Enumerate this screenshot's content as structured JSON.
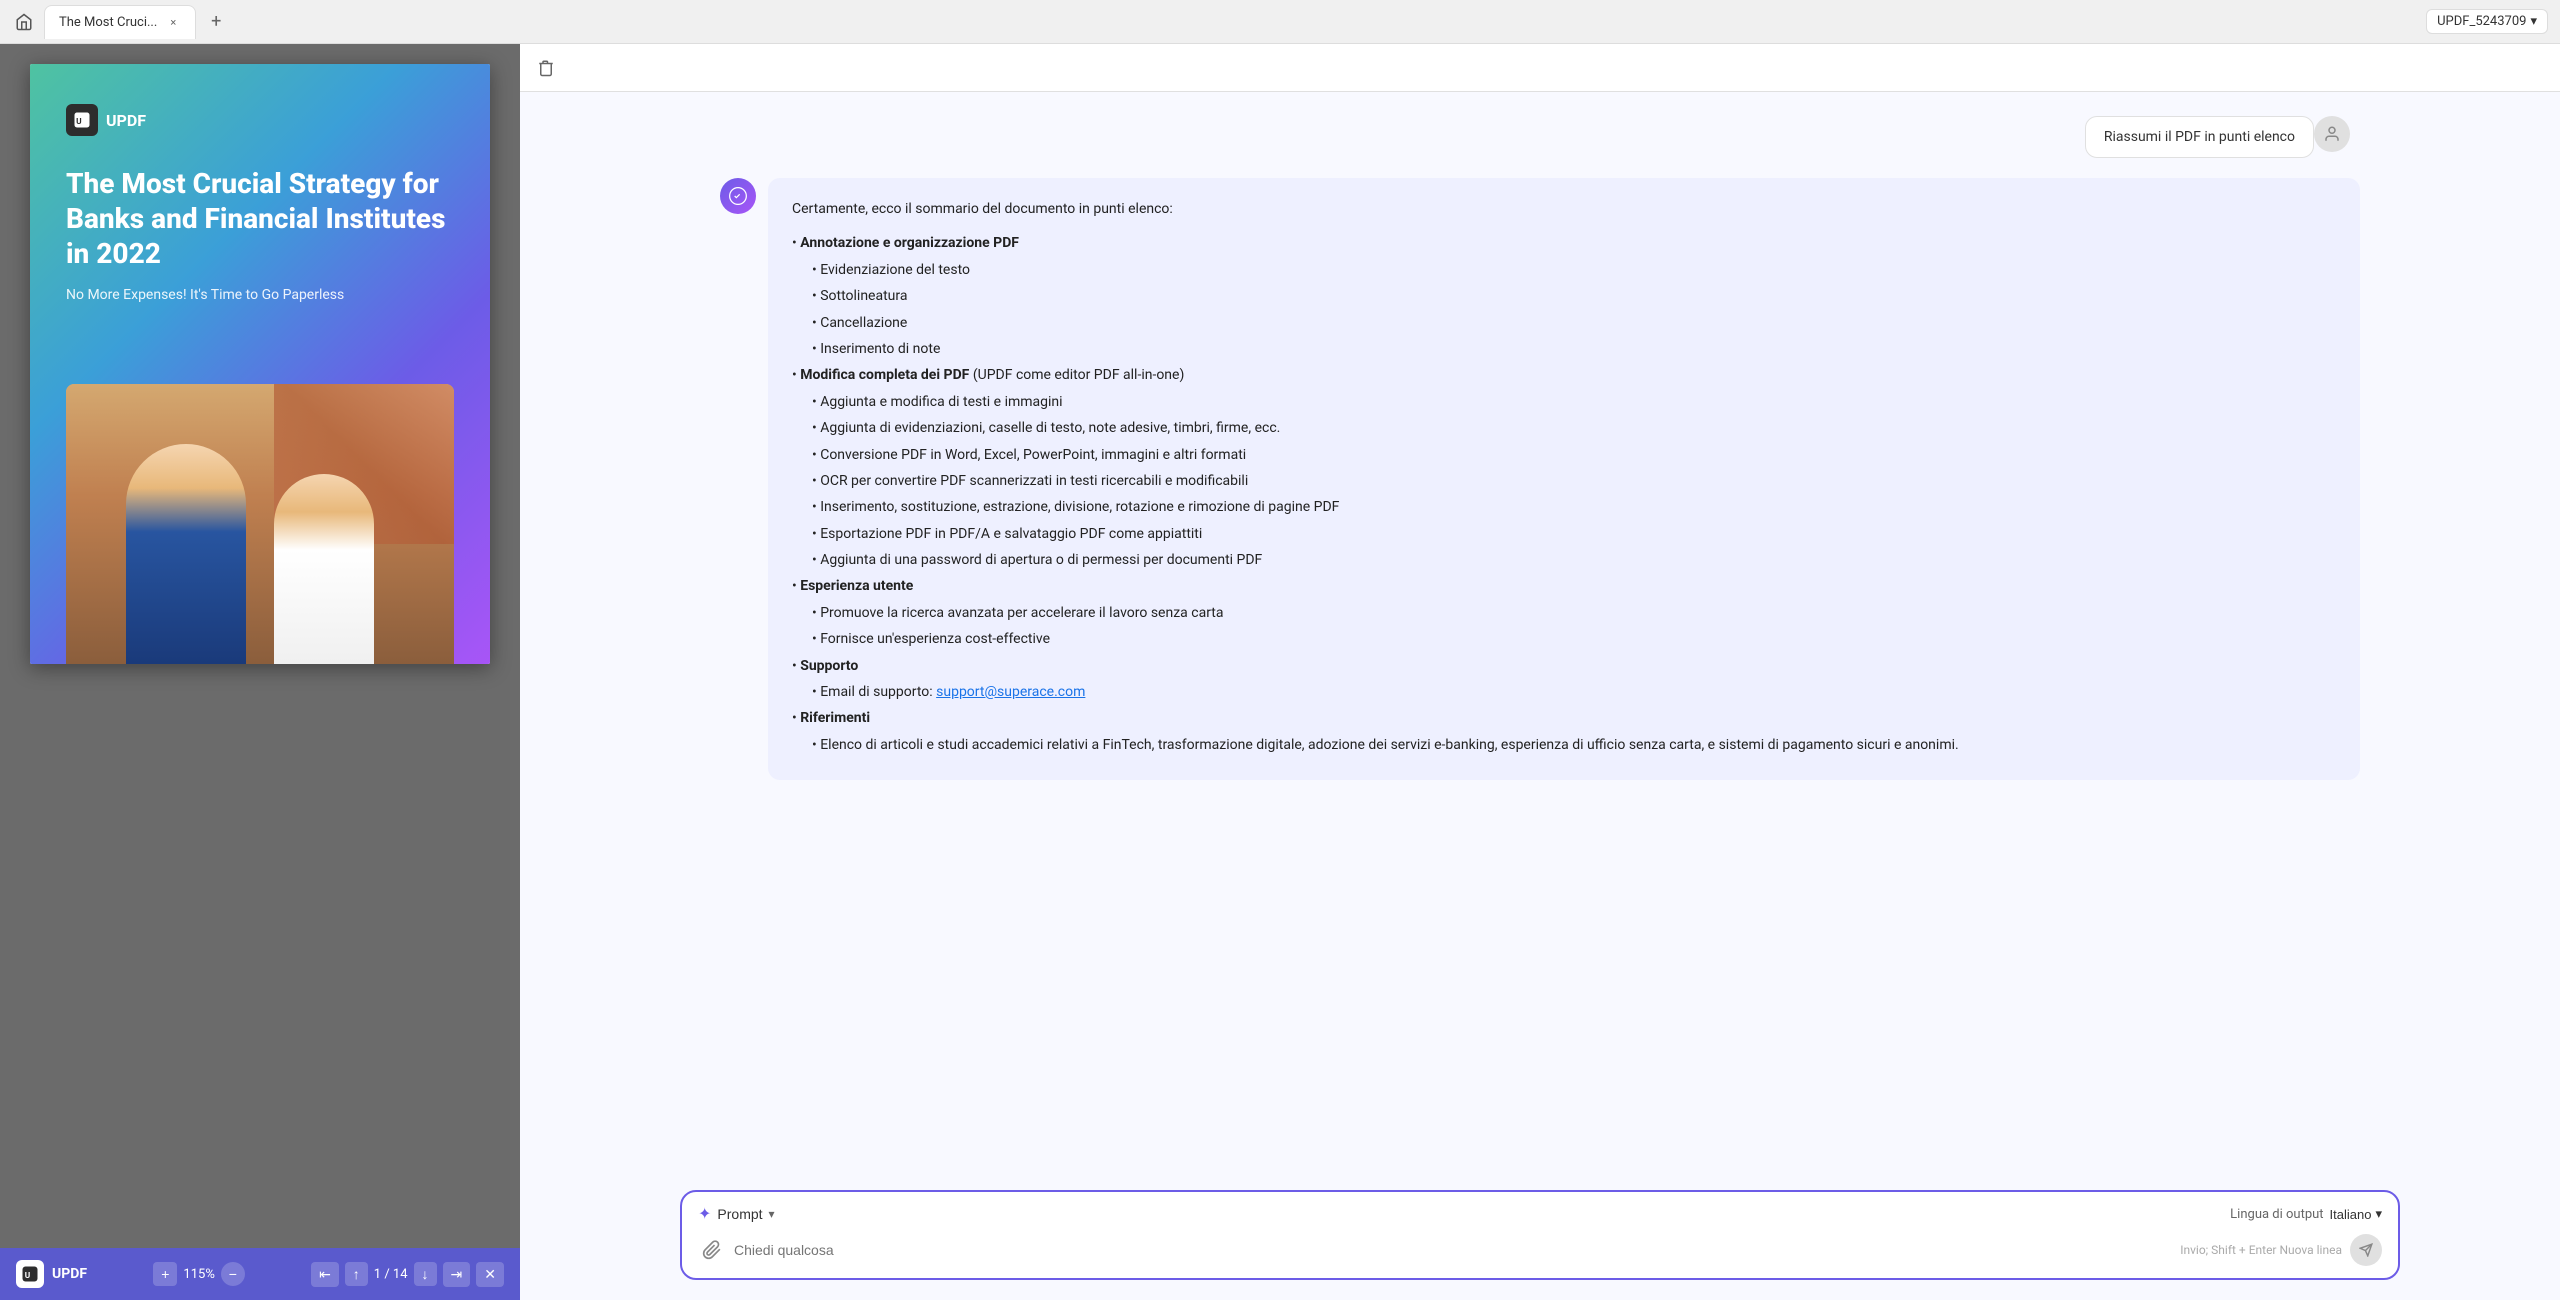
{
  "tabBar": {
    "homeIcon": "🏠",
    "tab": {
      "label": "The Most Cruci...",
      "closeIcon": "×"
    },
    "addTabIcon": "+",
    "account": {
      "label": "UPDF_5243709",
      "chevron": "▾"
    }
  },
  "pdfPanel": {
    "cover": {
      "logoText": "UPDF",
      "title": "The Most Crucial Strategy for Banks and Financial Institutes in 2022",
      "subtitle": "No More Expenses! It's Time to Go Paperless"
    },
    "bottomBar": {
      "brandText": "UPDF",
      "zoomLevel": "115%",
      "pageInfo": "1 / 14"
    }
  },
  "aiPanel": {
    "userMessage": "Riassumi il PDF in punti elenco",
    "aiResponse": {
      "intro": "Certamente, ecco il sommario del documento in punti elenco:",
      "sections": [
        {
          "title": "Annotazione e organizzazione PDF",
          "items": [
            "Evidenziazione del testo",
            "Sottolineatura",
            "Cancellazione",
            "Inserimento di note"
          ]
        },
        {
          "title": "Modifica completa dei PDF",
          "titleSuffix": " (UPDF come editor PDF all-in-one)",
          "items": [
            "Aggiunta e modifica di testi e immagini",
            "Aggiunta di evidenziazioni, caselle di testo, note adesive, timbri, firme, ecc.",
            "Conversione PDF in Word, Excel, PowerPoint, immagini e altri formati",
            "OCR per convertire PDF scannerizzati in testi ricercabili e modificabili",
            "Inserimento, sostituzione, estrazione, divisione, rotazione e rimozione di pagine PDF",
            "Esportazione PDF in PDF/A e salvataggio PDF come appiattiti",
            "Aggiunta di una password di apertura o di permessi per documenti PDF"
          ]
        },
        {
          "title": "Esperienza utente",
          "items": [
            "Promuove la ricerca avanzata per accelerare il lavoro senza carta",
            "Fornisce un'esperienza cost-effective"
          ]
        },
        {
          "title": "Supporto",
          "items": [
            "Email di supporto: support@superace.com"
          ]
        },
        {
          "title": "Riferimenti",
          "items": [
            "Elenco di articoli e studi accademici relativi a FinTech, trasformazione digitale, adozione dei servizi e-banking, esperienza di ufficio senza carta, e sistemi di pagamento sicuri e anonimi."
          ]
        }
      ]
    }
  },
  "inputArea": {
    "promptLabel": "Prompt",
    "promptChevron": "▾",
    "languageLabel": "Lingua di output",
    "languageValue": "Italiano",
    "languageChevron": "▾",
    "placeholder": "Chiedi qualcosa",
    "sendHint": "Invio; Shift + Enter Nuova linea",
    "attachIcon": "📎"
  }
}
